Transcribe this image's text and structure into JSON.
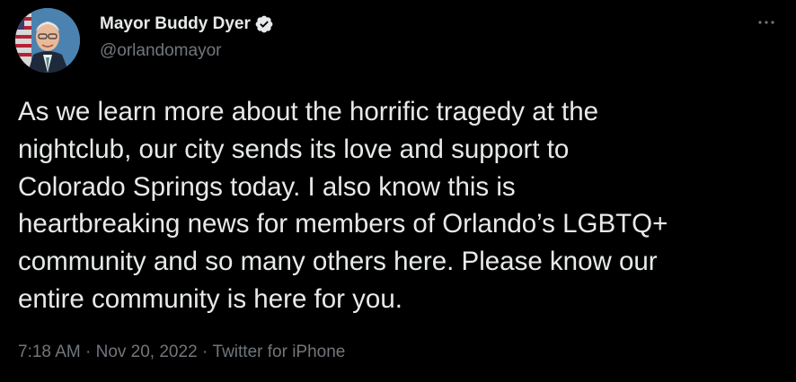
{
  "author": {
    "display_name": "Mayor Buddy Dyer",
    "handle": "@orlandomayor",
    "verified": true,
    "avatar_icon": "profile-photo"
  },
  "tweet": {
    "text": "As we learn more about the horrific tragedy at the\nnightclub, our city sends its love and support to\nColorado Springs today. I also know this is\nheartbreaking news for members of Orlando’s LGBTQ+\ncommunity and so many others here. Please know our\nentire community is here for you."
  },
  "meta": {
    "time": "7:18 AM",
    "separator": " · ",
    "date": "Nov 20, 2022",
    "source": "Twitter for iPhone"
  },
  "colors": {
    "background": "#000000",
    "primary_text": "#e7e9ea",
    "secondary_text": "#71767b"
  },
  "icons": {
    "verified": "verified-badge-icon",
    "more": "more-options-icon"
  }
}
